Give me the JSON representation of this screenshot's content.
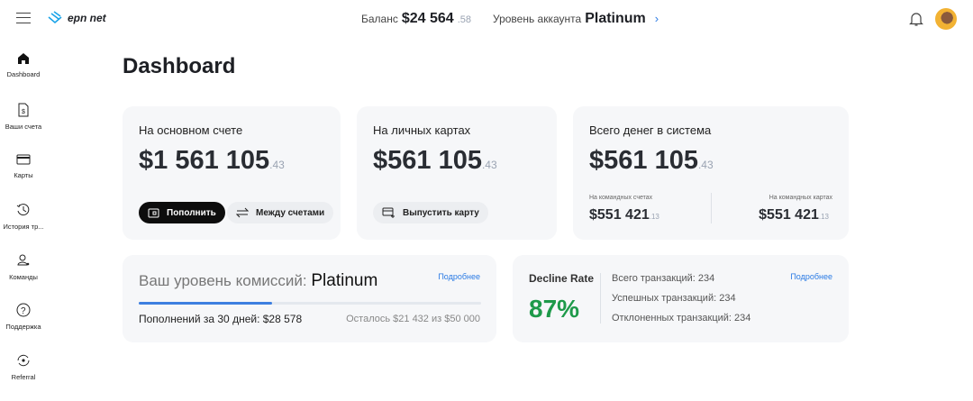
{
  "header": {
    "logo_text": "epn net",
    "balance_label": "Баланс",
    "balance_value": "$24 564",
    "balance_cents": ".58",
    "level_label": "Уровень аккаунта",
    "level_value": "Platinum"
  },
  "sidebar": {
    "items": [
      {
        "label": "Dashboard",
        "icon": "home-icon"
      },
      {
        "label": "Ваши счета",
        "icon": "document-dollar-icon"
      },
      {
        "label": "Карты",
        "icon": "card-icon"
      },
      {
        "label": "История тр...",
        "icon": "history-icon"
      },
      {
        "label": "Команды",
        "icon": "team-icon"
      },
      {
        "label": "Поддержка",
        "icon": "help-icon"
      },
      {
        "label": "Referral",
        "icon": "referral-icon"
      }
    ]
  },
  "page_title": "Dashboard",
  "cards": {
    "main": {
      "label": "На основном счете",
      "value": "$1 561 105",
      "cents": ".43",
      "topup": "Пополнить",
      "transfer": "Между счетами"
    },
    "personal": {
      "label": "На личных картах",
      "value": "$561 105",
      "cents": ".43",
      "issue": "Выпустить карту"
    },
    "total": {
      "label": "Всего денег в система",
      "value": "$561 105",
      "cents": ".43",
      "team_accounts_label": "На командных счетах",
      "team_accounts_value": "$551 421",
      "team_accounts_cents": ".13",
      "team_cards_label": "На командных картах",
      "team_cards_value": "$551 421",
      "team_cards_cents": ".13"
    }
  },
  "commission": {
    "label": "Ваш уровень комиссий:",
    "level": "Platinum",
    "more": "Подробнее",
    "deposits": "Пополнений за 30 дней: $28 578",
    "remaining": "Осталось $21 432 из $50 000",
    "progress": 0.39
  },
  "decline": {
    "label": "Decline Rate",
    "value": "87%",
    "total": "Всего транзакций: 234",
    "success": "Успешных транзакций: 234",
    "declined": "Отклоненных транзакций: 234",
    "more": "Подробнее"
  },
  "colors": {
    "accent": "#2b7be4",
    "success": "#1e9a4a",
    "card_bg": "#f6f7f9"
  }
}
